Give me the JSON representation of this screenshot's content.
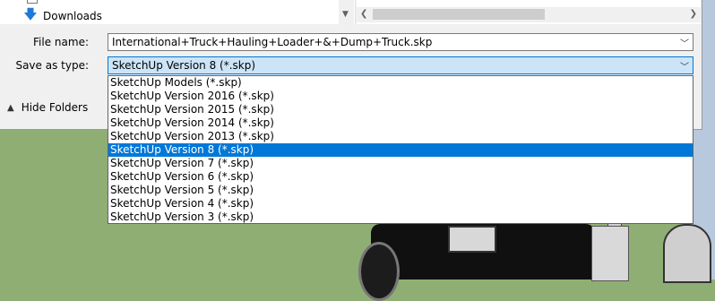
{
  "nav": {
    "folder_label": "Downloads"
  },
  "file_name": {
    "label": "File name:",
    "value": "International+Truck+Hauling+Loader+&+Dump+Truck.skp"
  },
  "save_as_type": {
    "label": "Save as type:",
    "value": "SketchUp Version 8 (*.skp)",
    "options": [
      "SketchUp Models (*.skp)",
      "SketchUp Version 2016 (*.skp)",
      "SketchUp Version 2015 (*.skp)",
      "SketchUp Version 2014 (*.skp)",
      "SketchUp Version 2013 (*.skp)",
      "SketchUp Version 8 (*.skp)",
      "SketchUp Version 7 (*.skp)",
      "SketchUp Version 6 (*.skp)",
      "SketchUp Version 5 (*.skp)",
      "SketchUp Version 4 (*.skp)",
      "SketchUp Version 3 (*.skp)"
    ],
    "selected_index": 5
  },
  "hide_folders_label": "Hide Folders",
  "colors": {
    "selection": "#0078d7",
    "field_highlight": "#cce4f7",
    "background_ground": "#8fae74"
  }
}
